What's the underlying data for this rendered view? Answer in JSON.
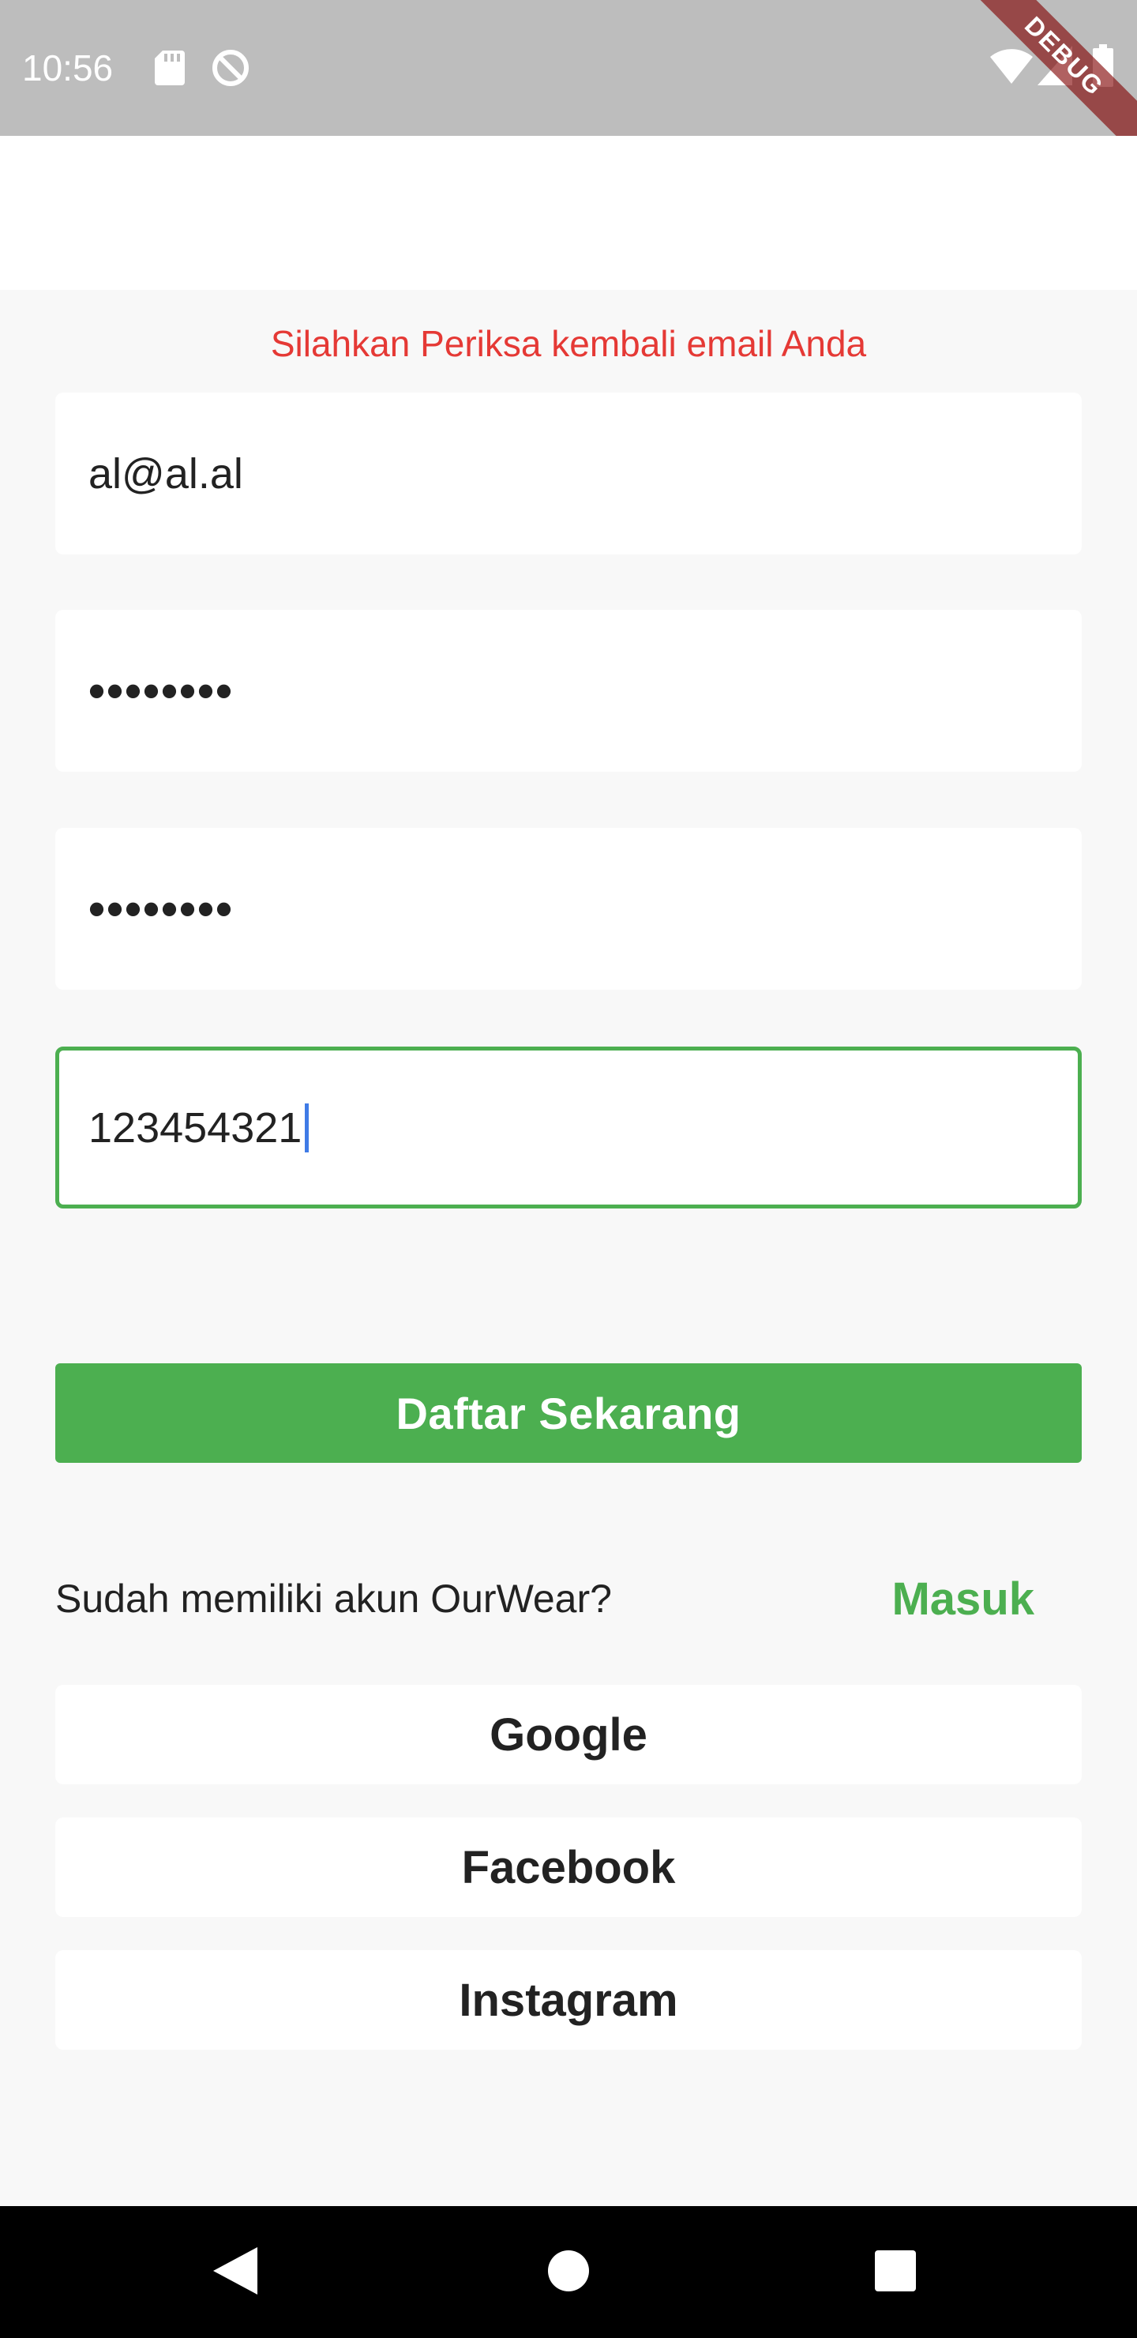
{
  "status_bar": {
    "time": "10:56",
    "icons": [
      "sd-card-icon",
      "sync-disabled-icon",
      "wifi-icon",
      "signal-icon",
      "battery-icon"
    ],
    "debug_label": "DEBUG"
  },
  "form": {
    "error_message": "Silahkan Periksa kembali email Anda",
    "email_value": "al@al.al",
    "password_value": "••••••••",
    "confirm_password_value": "••••••••",
    "phone_value": "123454321"
  },
  "actions": {
    "register_label": "Daftar Sekarang",
    "signin_prompt": "Sudah memiliki akun OurWear?",
    "signin_link": "Masuk"
  },
  "social": {
    "google": "Google",
    "facebook": "Facebook",
    "instagram": "Instagram"
  },
  "colors": {
    "accent": "#4caf50",
    "error": "#e53935",
    "status_bar": "#bdbdbd",
    "background": "#f8f8f8"
  },
  "nav": {
    "icons": [
      "back-icon",
      "home-icon",
      "recents-icon"
    ]
  }
}
